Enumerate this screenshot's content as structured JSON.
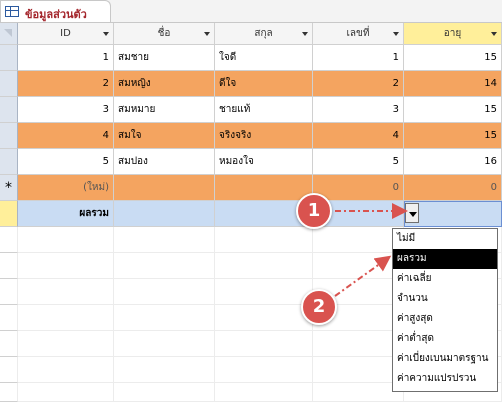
{
  "tab": {
    "label": "ข้อมูลส่วนตัว"
  },
  "columns": [
    "ID",
    "ชื่อ",
    "สกุล",
    "เลขที่",
    "อายุ"
  ],
  "rows": [
    {
      "id": "1",
      "name": "สมชาย",
      "surname": "ใจดี",
      "number": "1",
      "age": "15"
    },
    {
      "id": "2",
      "name": "สมหญิง",
      "surname": "ดีใจ",
      "number": "2",
      "age": "14"
    },
    {
      "id": "3",
      "name": "สมหมาย",
      "surname": "ชายแท้",
      "number": "3",
      "age": "15"
    },
    {
      "id": "4",
      "name": "สมใจ",
      "surname": "จริงจริง",
      "number": "4",
      "age": "15"
    },
    {
      "id": "5",
      "name": "สมปอง",
      "surname": "หมองใจ",
      "number": "5",
      "age": "16"
    }
  ],
  "new_row": {
    "marker": "*",
    "id": "(ใหม่)",
    "number": "0",
    "age": "0"
  },
  "totals_row": {
    "label": "ผลรวม"
  },
  "dropdown": {
    "options": [
      "ไม่มี",
      "ผลรวม",
      "ค่าเฉลี่ย",
      "จำนวน",
      "ค่าสูงสุด",
      "ค่าต่ำสุด",
      "ค่าเบี่ยงเบนมาตรฐาน",
      "ค่าความแปรปรวน"
    ],
    "selected": "ผลรวม"
  },
  "callouts": [
    "1",
    "2"
  ],
  "colors": {
    "row_alt": "#f4a460",
    "totals_row": "#c9dcf3",
    "header_selected": "#ffef9a",
    "callout": "#d9534f"
  }
}
